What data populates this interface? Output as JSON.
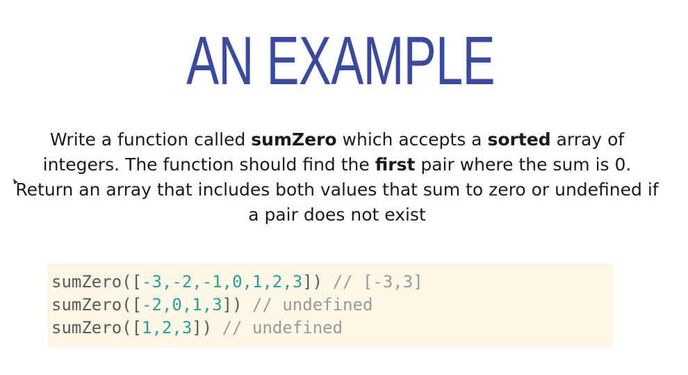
{
  "slide": {
    "title": "AN EXAMPLE",
    "description": {
      "part1": "Write a function called ",
      "bold1": "sumZero",
      "part2": " which accepts a ",
      "bold2": "sorted",
      "part3": " array of integers. The function should find the ",
      "bold3": "first",
      "part4": " pair where the sum is 0. Return an array that includes both values that sum to zero or undefined if a pair does not exist"
    },
    "code_lines": [
      {
        "fn_open": "sumZero([",
        "nums": "-3,-2,-1,0,1,2,3",
        "fn_close": "]) ",
        "comment": "// [-3,3]"
      },
      {
        "fn_open": "sumZero([",
        "nums": "-2,0,1,3",
        "fn_close": "]) ",
        "comment": "// undefined"
      },
      {
        "fn_open": "sumZero([",
        "nums": "1,2,3",
        "fn_close": "]) ",
        "comment": "// undefined"
      }
    ]
  },
  "colors": {
    "title": "#3b4a9c",
    "code_background": "#fcf6e7",
    "numbers": "#2e9c95",
    "comments": "#9a9a9a"
  },
  "icons": {
    "pointer": "mouse-cursor-icon"
  }
}
